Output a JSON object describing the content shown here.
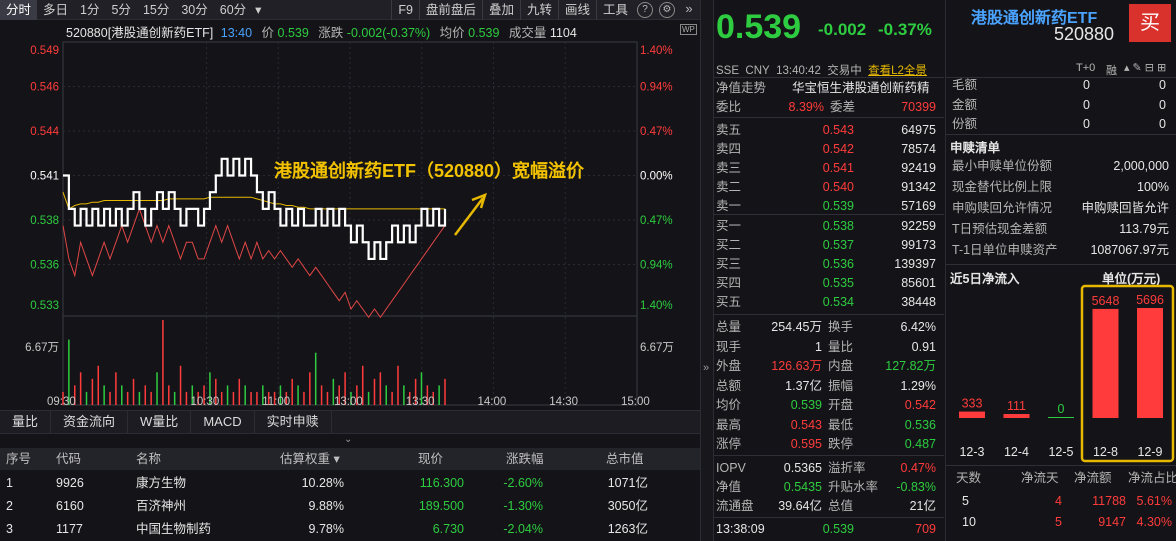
{
  "toolbar": {
    "tabs": [
      "分时",
      "多日",
      "1分",
      "5分",
      "15分",
      "30分",
      "60分"
    ],
    "dropdown": "▾",
    "right": [
      "F9",
      "盘前盘后",
      "叠加",
      "九转",
      "画线",
      "工具"
    ]
  },
  "chart": {
    "header": {
      "name": "520880[港股通创新药ETF]",
      "time": "13:40",
      "price_label": "价",
      "price": "0.539",
      "change_label": "涨跌",
      "change": "-0.002(-0.37%)",
      "avg_label": "均价",
      "avg": "0.539",
      "vol_label": "成交量",
      "vol": "1104"
    },
    "left_ticks": [
      "0.549",
      "0.546",
      "0.544",
      "0.541",
      "0.538",
      "0.536",
      "0.533"
    ],
    "right_ticks": [
      "1.40%",
      "0.94%",
      "0.47%",
      "0.00%",
      "0.47%",
      "0.94%",
      "1.40%"
    ],
    "vol_tick": "6.67万",
    "vol_tick_r": "6.67万",
    "x_ticks": [
      "09:30",
      "10:30",
      "11:00",
      "13:00",
      "13:30",
      "14:00",
      "14:30",
      "15:00"
    ],
    "annotation": "港股通创新药ETF（520880）宽幅溢价",
    "price_series": [
      0.541,
      0.539,
      0.538,
      0.539,
      0.538,
      0.539,
      0.538,
      0.539,
      0.538,
      0.539,
      0.538,
      0.539,
      0.54,
      0.539,
      0.538,
      0.539,
      0.54,
      0.539,
      0.54,
      0.539,
      0.538,
      0.539,
      0.539,
      0.538,
      0.539,
      0.54,
      0.541,
      0.542,
      0.541,
      0.542,
      0.541,
      0.542,
      0.541,
      0.54,
      0.539,
      0.54,
      0.539,
      0.538,
      0.539,
      0.538,
      0.539,
      0.538,
      0.538,
      0.539,
      0.538,
      0.539,
      0.538,
      0.539,
      0.538,
      0.537,
      0.538,
      0.537,
      0.536,
      0.537,
      0.536,
      0.537,
      0.538,
      0.537,
      0.538,
      0.537,
      0.538,
      0.539,
      0.538,
      0.539,
      0.538,
      0.539
    ],
    "avg_series": [
      0.54,
      0.539,
      0.5392,
      0.5393,
      0.5393,
      0.5394,
      0.5394,
      0.5395,
      0.5395,
      0.5395,
      0.5395,
      0.5395,
      0.5395,
      0.5395,
      0.5395,
      0.5395,
      0.5395,
      0.5395,
      0.5396,
      0.5396,
      0.5396,
      0.5396,
      0.5396,
      0.5396,
      0.5396,
      0.5397,
      0.5397,
      0.5397,
      0.5397,
      0.5397,
      0.5397,
      0.5397,
      0.5397,
      0.5396,
      0.5395,
      0.5394,
      0.5393,
      0.5393,
      0.5392,
      0.5392,
      0.5391,
      0.5391,
      0.539,
      0.539,
      0.539,
      0.539,
      0.539,
      0.539,
      0.539,
      0.539,
      0.539,
      0.539,
      0.539,
      0.539,
      0.539,
      0.539,
      0.539,
      0.539,
      0.539,
      0.539,
      0.539,
      0.539,
      0.539,
      0.539,
      0.539,
      0.539
    ],
    "iopv_series": [
      0.538,
      0.536,
      0.535,
      0.537,
      0.536,
      0.535,
      0.536,
      0.537,
      0.536,
      0.537,
      0.538,
      0.537,
      0.538,
      0.539,
      0.538,
      0.537,
      0.538,
      0.537,
      0.538,
      0.537,
      0.536,
      0.537,
      0.537,
      0.536,
      0.536,
      0.537,
      0.538,
      0.537,
      0.538,
      0.537,
      0.536,
      0.537,
      0.536,
      0.537,
      0.536,
      0.5365,
      0.536,
      0.5365,
      0.536,
      0.5355,
      0.536,
      0.5355,
      0.535,
      0.5355,
      0.535,
      0.5345,
      0.534,
      0.5335,
      0.534,
      0.533,
      0.5335,
      0.533,
      0.5325,
      0.533,
      0.5325,
      0.533,
      0.5335,
      0.534,
      0.5345,
      0.535,
      0.5355,
      0.536,
      0.5365,
      0.537,
      0.5375,
      0.538
    ],
    "volumes": [
      0.2,
      1.0,
      0.3,
      0.5,
      0.2,
      0.4,
      0.6,
      0.3,
      0.2,
      0.5,
      0.3,
      0.2,
      0.4,
      0.2,
      0.3,
      0.2,
      0.5,
      1.3,
      0.3,
      0.2,
      0.6,
      0.2,
      0.3,
      0.2,
      0.3,
      0.5,
      0.4,
      0.2,
      0.3,
      0.2,
      0.4,
      0.3,
      0.2,
      0.2,
      0.3,
      0.2,
      0.2,
      0.3,
      0.2,
      0.4,
      0.3,
      0.2,
      0.5,
      0.8,
      0.3,
      0.2,
      0.4,
      0.3,
      0.5,
      0.2,
      0.3,
      0.6,
      0.2,
      0.4,
      0.5,
      0.3,
      0.2,
      0.6,
      0.3,
      0.2,
      0.4,
      0.5,
      0.3,
      0.2,
      0.3,
      0.4
    ]
  },
  "indicators": [
    "量比",
    "资金流向",
    "W量比",
    "MACD",
    "实时申赎"
  ],
  "table": {
    "headers": [
      "序号",
      "代码",
      "名称",
      "估算权重 ▾",
      "现价",
      "涨跌幅",
      "总市值"
    ],
    "rows": [
      [
        "1",
        "9926",
        "康方生物",
        "10.28%",
        "116.300",
        "-2.60%",
        "1071亿"
      ],
      [
        "2",
        "6160",
        "百济神州",
        "9.88%",
        "189.500",
        "-1.30%",
        "3050亿"
      ],
      [
        "3",
        "1177",
        "中国生物制药",
        "9.78%",
        "6.730",
        "-2.04%",
        "1263亿"
      ]
    ]
  },
  "quote": {
    "price": "0.539",
    "change": "-0.002",
    "pct": "-0.37%",
    "name": "港股通创新药ETF",
    "code": "520880",
    "buy": "买",
    "sub": [
      "SSE",
      "CNY",
      "13:40:42",
      "交易中",
      "查看L2全景"
    ],
    "t0": "T+0",
    "margin": "融",
    "nav_label": "净值走势",
    "index": "华宝恒生港股通创新药精",
    "weibi_label": "委比",
    "weibi": "8.39%",
    "weicha_label": "委差",
    "weicha": "70399",
    "asks": [
      [
        "卖五",
        "0.543",
        "64975"
      ],
      [
        "卖四",
        "0.542",
        "78574"
      ],
      [
        "卖三",
        "0.541",
        "92419"
      ],
      [
        "卖二",
        "0.540",
        "91342"
      ],
      [
        "卖一",
        "0.539",
        "57169"
      ]
    ],
    "bids": [
      [
        "买一",
        "0.538",
        "92259"
      ],
      [
        "买二",
        "0.537",
        "99173"
      ],
      [
        "买三",
        "0.536",
        "139397"
      ],
      [
        "买四",
        "0.535",
        "85601"
      ],
      [
        "买五",
        "0.534",
        "38448"
      ]
    ],
    "stats": [
      [
        "总量",
        "254.45万",
        "换手",
        "6.42%"
      ],
      [
        "现手",
        "1",
        "量比",
        "0.91"
      ],
      [
        "外盘",
        "126.63万",
        "内盘",
        "127.82万"
      ],
      [
        "总额",
        "1.37亿",
        "振幅",
        "1.29%"
      ],
      [
        "均价",
        "0.539",
        "开盘",
        "0.542"
      ],
      [
        "最高",
        "0.543",
        "最低",
        "0.536"
      ],
      [
        "涨停",
        "0.595",
        "跌停",
        "0.487"
      ]
    ],
    "iopv": [
      [
        "IOPV",
        "0.5365",
        "溢折率",
        "0.47%"
      ],
      [
        "净值",
        "0.5435",
        "升贴水率",
        "-0.83%"
      ],
      [
        "流通盘",
        "39.64亿",
        "总值",
        "21亿"
      ]
    ],
    "last": [
      "13:38:09",
      "0.539",
      "709"
    ]
  },
  "right": {
    "top": [
      [
        "毛额",
        "0",
        "0"
      ],
      [
        "金额",
        "0",
        "0"
      ],
      [
        "份额",
        "0",
        "0"
      ]
    ],
    "list_title": "申赎清单",
    "list": [
      [
        "最小申赎单位份额",
        "2,000,000"
      ],
      [
        "现金替代比例上限",
        "100%"
      ],
      [
        "申购赎回允许情况",
        "申购赎回皆允许"
      ],
      [
        "T日预估现金差额",
        "113.79元"
      ],
      [
        "T-1日单位申赎资产",
        "1087067.97元"
      ]
    ],
    "flow_title": "近5日净流入",
    "flow_unit": "单位(万元)",
    "flow": {
      "labels": [
        "12-3",
        "12-4",
        "12-5",
        "12-8",
        "12-9"
      ],
      "values": [
        333,
        111,
        0,
        5648,
        5696
      ]
    },
    "foot_head": [
      "天数",
      "净流天",
      "净流额",
      "净流占比"
    ],
    "foot": [
      [
        "5",
        "4",
        "11788",
        "5.61%"
      ],
      [
        "10",
        "5",
        "9147",
        "4.30%"
      ]
    ]
  },
  "colors": {
    "up": "#ff3b3b",
    "down": "#2ecc40",
    "price_line": "#ffffff",
    "avg_line": "#e6b800",
    "iopv_line": "#e04646",
    "highlight": "#e6b800"
  }
}
